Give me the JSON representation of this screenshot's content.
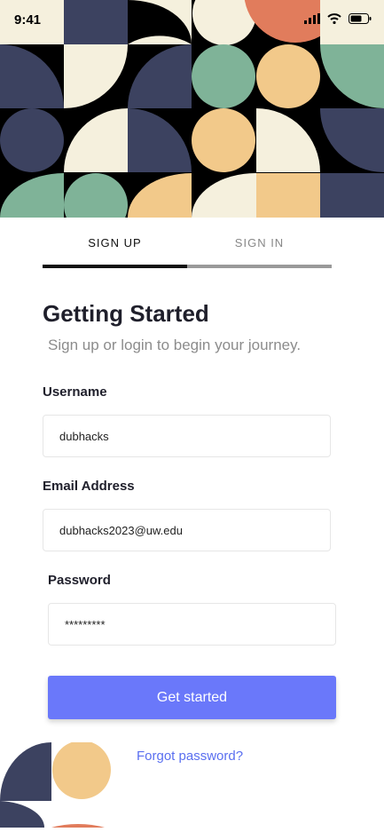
{
  "status_bar": {
    "time": "9:41"
  },
  "tabs": [
    {
      "label": "SIGN UP",
      "active": true
    },
    {
      "label": "SIGN IN",
      "active": false
    }
  ],
  "heading": {
    "title": "Getting Started",
    "subtitle": "Sign up or login to begin your journey."
  },
  "form": {
    "username": {
      "label": "Username",
      "value": "dubhacks"
    },
    "email": {
      "label": "Email Address",
      "value": "dubhacks2023@uw.edu"
    },
    "password": {
      "label": "Password",
      "value": "*********"
    }
  },
  "actions": {
    "submit_label": "Get started",
    "forgot_label": "Forgot password?"
  },
  "colors": {
    "accent": "#6a78fa",
    "navy": "#3c4260",
    "cream": "#f5f0dd",
    "sage": "#7fb398",
    "sand": "#f2c98a",
    "coral": "#e17c5c",
    "black": "#000000"
  },
  "icons": [
    "cellular-signal-icon",
    "wifi-icon",
    "battery-icon"
  ]
}
